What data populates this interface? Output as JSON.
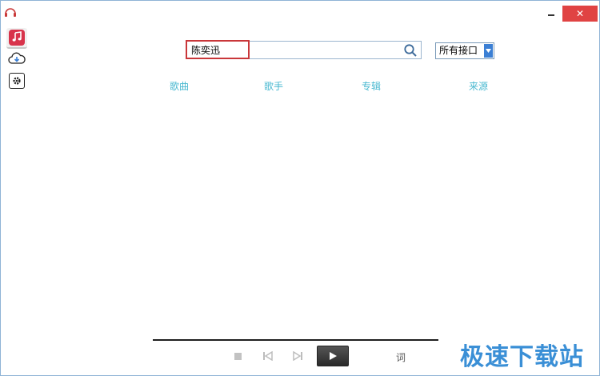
{
  "window": {
    "close_glyph": "✕"
  },
  "search": {
    "value": "陈奕迅",
    "placeholder": ""
  },
  "source_select": {
    "selected": "所有接口"
  },
  "columns": [
    "歌曲",
    "歌手",
    "专辑",
    "来源"
  ],
  "player": {
    "lyrics_label": "词"
  },
  "watermark": {
    "text": "极速下载站"
  },
  "colors": {
    "accent": "#48b8d0",
    "close": "#e04343",
    "music_tab": "#d8334b",
    "highlight": "#c9373a",
    "watermark": "#3a8fd6"
  },
  "icons": {
    "app": "headphones-icon",
    "music": "music-note-icon",
    "cloud": "cloud-download-icon",
    "settings": "gear-icon",
    "search": "search-icon"
  }
}
